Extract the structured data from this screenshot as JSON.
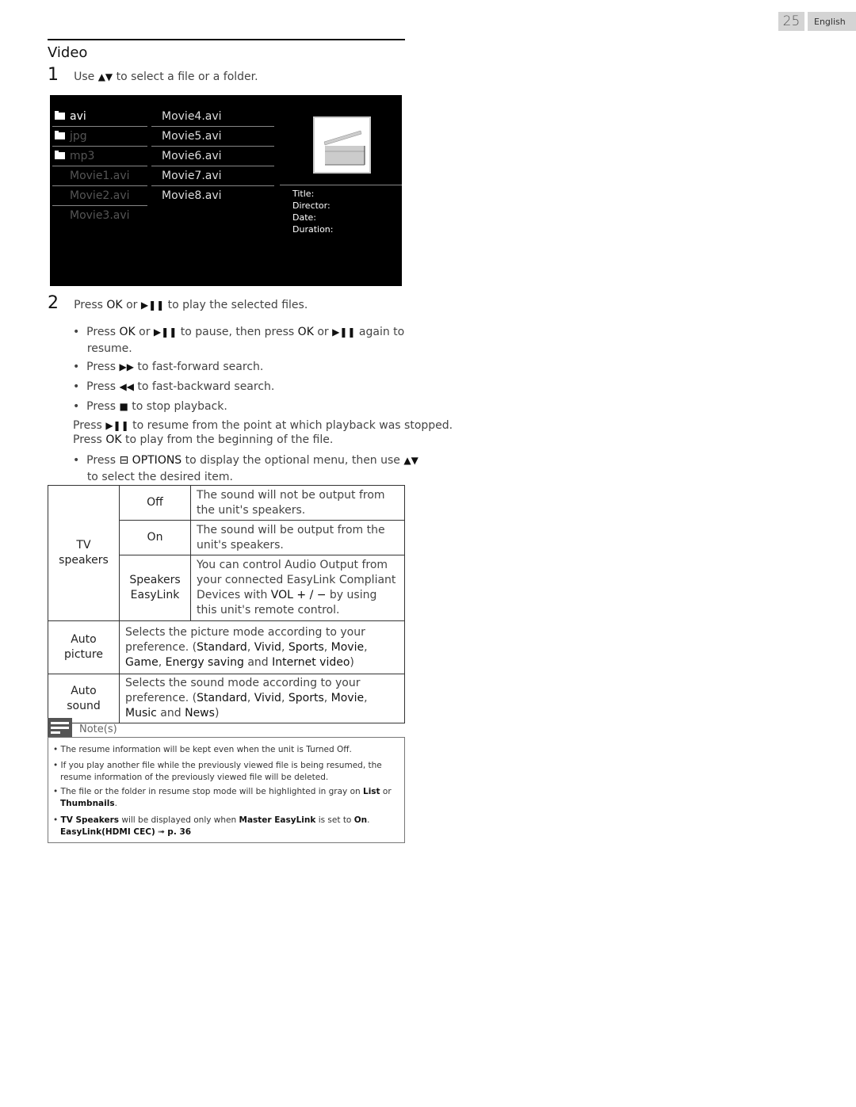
{
  "header": {
    "page_number": "25",
    "language": "English"
  },
  "section_title": "Video",
  "step1": {
    "num": "1",
    "pre": "Use",
    "arrows": "▲▼",
    "post": "to select a file or a folder."
  },
  "browser": {
    "col1": [
      {
        "label": "avi",
        "type": "folder",
        "state": "active"
      },
      {
        "label": "jpg",
        "type": "folder",
        "state": "dim"
      },
      {
        "label": "mp3",
        "type": "folder",
        "state": "dim"
      },
      {
        "label": "Movie1.avi",
        "type": "file",
        "state": "dim"
      },
      {
        "label": "Movie2.avi",
        "type": "file",
        "state": "dim"
      },
      {
        "label": "Movie3.avi",
        "type": "file",
        "state": "dim"
      }
    ],
    "col2": [
      "Movie4.avi",
      "Movie5.avi",
      "Movie6.avi",
      "Movie7.avi",
      "Movie8.avi"
    ],
    "info_labels": [
      "Title:",
      "Director:",
      "Date:",
      "Duration:"
    ]
  },
  "step2": {
    "num": "2",
    "pre": "Press",
    "ok": "OK",
    "or": "or",
    "playpause": "▶❚❚",
    "post": "to play the selected files."
  },
  "bullets": {
    "b1": {
      "a": "Press",
      "ok": "OK",
      "or": "or",
      "sym": "▶❚❚",
      "b": "to pause, then press",
      "ok2": "OK",
      "or2": "or",
      "sym2": "▶❚❚",
      "c": "again to",
      "d": "resume."
    },
    "b2": {
      "a": "Press",
      "sym": "▶▶",
      "b": "to fast-forward search."
    },
    "b3": {
      "a": "Press",
      "sym": "◀◀",
      "b": "to fast-backward search."
    },
    "b4": {
      "a": "Press",
      "sym": "■",
      "b": "to stop playback."
    }
  },
  "resume_para": {
    "l1_pre": "Press",
    "l1_sym": "▶❚❚",
    "l1_post": "to resume from the point at which playback was stopped.",
    "l2_pre": "Press",
    "l2_ok": "OK",
    "l2_post": "to play from the beginning of the file."
  },
  "options_bullet": {
    "a": "Press",
    "sym": "⊟",
    "opt": "OPTIONS",
    "b": "to display the optional menu, then use",
    "arrows": "▲▼",
    "c": "to select the desired item."
  },
  "options_table": {
    "tv_speakers": "TV speakers",
    "rows": [
      {
        "option": "Off",
        "desc": "The sound will not be output from the unit's speakers."
      },
      {
        "option": "On",
        "desc": "The sound will be output from the unit's speakers."
      },
      {
        "option": "Speakers EasyLink",
        "desc_a": "You can control Audio Output from your connected EasyLink Compliant Devices with",
        "desc_b": "VOL + / −",
        "desc_c": "by using this unit's remote control."
      }
    ],
    "auto_picture": {
      "label": "Auto picture",
      "desc": "Selects the picture mode according to your preference.",
      "modes": [
        "Standard",
        "Vivid",
        "Sports",
        "Movie",
        "Game",
        "Energy saving",
        "Internet video"
      ]
    },
    "auto_sound": {
      "label": "Auto sound",
      "desc": "Selects the sound mode according to your preference.",
      "modes": [
        "Standard",
        "Vivid",
        "Sports",
        "Movie",
        "Music",
        "News"
      ]
    }
  },
  "notes": {
    "label": "Note(s)",
    "n1": "The resume information will be kept even when the unit is Turned Off.",
    "n2": "If you play another file while the previously viewed file is being resumed, the resume information of the previously viewed file will be deleted.",
    "n3_a": "The file or the folder in resume stop mode will be highlighted in gray on",
    "n3_list": "List",
    "n3_or": "or",
    "n3_thumb": "Thumbnails",
    "n3_end": ".",
    "n4_tv": "TV Speakers",
    "n4_a": "will be displayed only when",
    "n4_master": "Master EasyLink",
    "n4_b": "is set to",
    "n4_on": "On",
    "n4_end": ".",
    "n4_link": "EasyLink(HDMI CEC)",
    "n4_arrow": "➟",
    "n4_page": "p. 36"
  },
  "colors": {
    "screen_bg": "#000000",
    "active_text": "#ffffff",
    "dim_text": "#555555",
    "header_box": "#d4d4d4"
  }
}
